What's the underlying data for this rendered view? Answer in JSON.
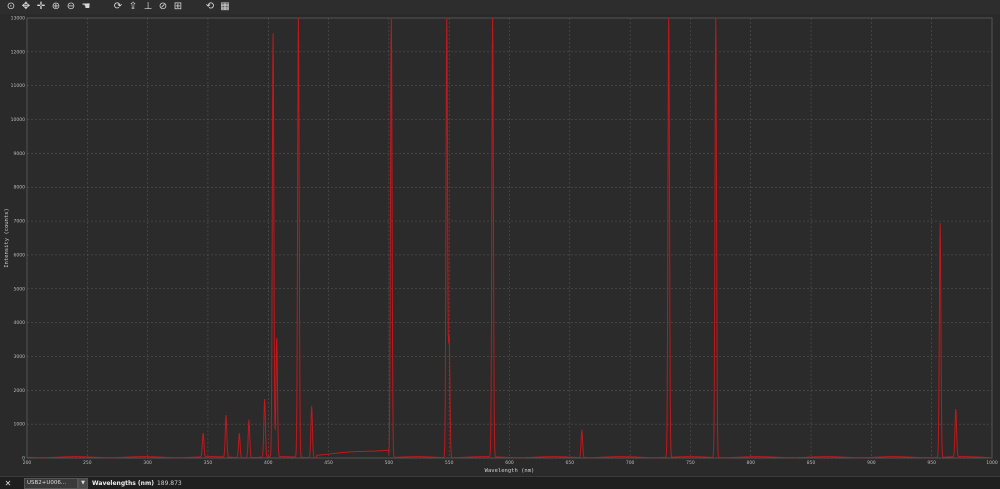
{
  "toolbar": {
    "buttons": [
      {
        "name": "reset-view-icon",
        "glyph": "⊙"
      },
      {
        "name": "pan-icon",
        "glyph": "✥"
      },
      {
        "name": "move-crosshair-icon",
        "glyph": "✛"
      },
      {
        "name": "zoom-in-icon",
        "glyph": "⊕"
      },
      {
        "name": "zoom-out-icon",
        "glyph": "⊖"
      },
      {
        "name": "hand-icon",
        "glyph": "☚"
      },
      {
        "name": "sep",
        "glyph": ""
      },
      {
        "name": "refresh-icon",
        "glyph": "⟳"
      },
      {
        "name": "export-icon",
        "glyph": "⇪"
      },
      {
        "name": "baseline-icon",
        "glyph": "⊥"
      },
      {
        "name": "no-entry-icon",
        "glyph": "⊘"
      },
      {
        "name": "graticule-icon",
        "glyph": "⊞"
      },
      {
        "name": "sep",
        "glyph": ""
      },
      {
        "name": "sync-icon",
        "glyph": "⟲"
      },
      {
        "name": "table-icon",
        "glyph": "▦"
      }
    ]
  },
  "chart_data": {
    "type": "line",
    "xlabel": "Wavelength (nm)",
    "ylabel": "Intensity (counts)",
    "xlim": [
      200,
      1000
    ],
    "ylim": [
      0,
      13000
    ],
    "x_ticks": [
      200,
      250,
      300,
      350,
      400,
      450,
      500,
      550,
      600,
      650,
      700,
      750,
      800,
      850,
      900,
      950,
      1000
    ],
    "y_ticks": [
      0,
      1000,
      2000,
      3000,
      4000,
      5000,
      6000,
      7000,
      8000,
      9000,
      10000,
      11000,
      12000,
      13000
    ],
    "x_tick_labels": [
      "200",
      "250",
      "300",
      "350",
      "400",
      "450",
      "500",
      "550",
      "600",
      "650",
      "700",
      "750",
      "800",
      "850",
      "900",
      "950",
      "1000"
    ],
    "y_tick_labels": [
      "0",
      "1000",
      "2000",
      "3000",
      "4000",
      "5000",
      "6000",
      "7000",
      "8000",
      "9000",
      "10000",
      "11000",
      "12000",
      "13000"
    ],
    "grid": true,
    "series_color": "#c0181c",
    "series": [
      {
        "peaks": [
          {
            "x": 346,
            "y": 700
          },
          {
            "x": 365,
            "y": 1230
          },
          {
            "x": 376,
            "y": 700
          },
          {
            "x": 384,
            "y": 1100
          },
          {
            "x": 397,
            "y": 1700
          },
          {
            "x": 404,
            "y": 12500
          },
          {
            "x": 407,
            "y": 3500
          },
          {
            "x": 425,
            "y": 13000
          },
          {
            "x": 436,
            "y": 1500
          },
          {
            "x": 502,
            "y": 13000
          },
          {
            "x": 548,
            "y": 13000
          },
          {
            "x": 550,
            "y": 3500
          },
          {
            "x": 586,
            "y": 13000
          },
          {
            "x": 660,
            "y": 800
          },
          {
            "x": 732,
            "y": 13000
          },
          {
            "x": 771,
            "y": 13000
          },
          {
            "x": 957,
            "y": 6900
          },
          {
            "x": 970,
            "y": 1400
          }
        ]
      }
    ]
  },
  "status": {
    "close_glyph": "✕",
    "device": "USB2+U006...",
    "axis_label": "Wavelengths (nm)",
    "axis_value": "189.873"
  }
}
